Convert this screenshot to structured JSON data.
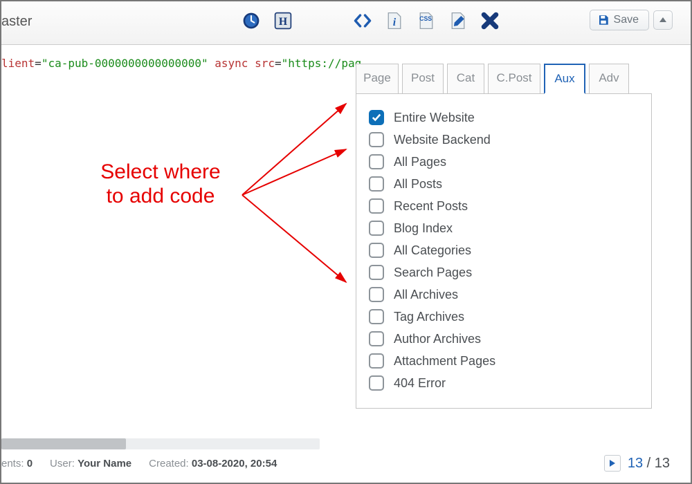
{
  "page_title_fragment": "aster",
  "toolbar": {
    "save_label": "Save"
  },
  "code": {
    "attr1": "lient",
    "val1": "\"ca-pub-0000000000000000\"",
    "async": " async ",
    "attr2": "src",
    "val2": "\"https://pag"
  },
  "annotation": "Select where\nto add code",
  "tabs": [
    "Page",
    "Post",
    "Cat",
    "C.Post",
    "Aux",
    "Adv"
  ],
  "active_tab": 4,
  "aux_options": [
    {
      "label": "Entire Website",
      "checked": true
    },
    {
      "label": "Website Backend",
      "checked": false
    },
    {
      "label": "All Pages",
      "checked": false
    },
    {
      "label": "All Posts",
      "checked": false
    },
    {
      "label": "Recent Posts",
      "checked": false
    },
    {
      "label": "Blog Index",
      "checked": false
    },
    {
      "label": "All Categories",
      "checked": false
    },
    {
      "label": "Search Pages",
      "checked": false
    },
    {
      "label": "All Archives",
      "checked": false
    },
    {
      "label": "Tag Archives",
      "checked": false
    },
    {
      "label": "Author Archives",
      "checked": false
    },
    {
      "label": "Attachment Pages",
      "checked": false
    },
    {
      "label": "404 Error",
      "checked": false
    }
  ],
  "status": {
    "ents_label": "ents: ",
    "ents_value": "0",
    "user_label": "User: ",
    "user_value": "Your Name",
    "created_label": "Created: ",
    "created_value": "03-08-2020, 20:54"
  },
  "pager": {
    "current": "13",
    "total": "13",
    "sep": " / "
  }
}
